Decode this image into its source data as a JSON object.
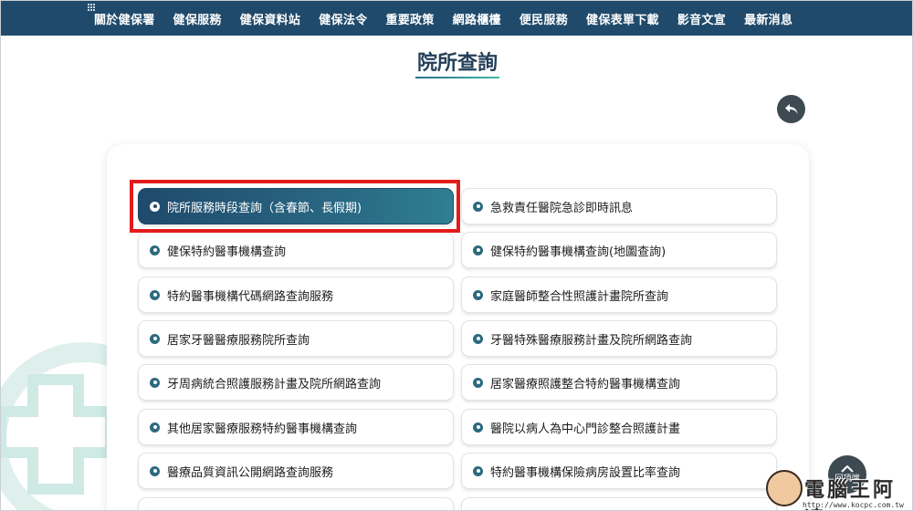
{
  "nav": {
    "items": [
      {
        "label": "關於健保署"
      },
      {
        "label": "健保服務"
      },
      {
        "label": "健保資料站"
      },
      {
        "label": "健保法令"
      },
      {
        "label": "重要政策"
      },
      {
        "label": "網路櫃檯"
      },
      {
        "label": "便民服務"
      },
      {
        "label": "健保表單下載"
      },
      {
        "label": "影音文宣"
      },
      {
        "label": "最新消息"
      }
    ]
  },
  "page": {
    "title": "院所查詢"
  },
  "links": [
    {
      "label": "院所服務時段查詢（含春節、長假期)",
      "active": true
    },
    {
      "label": "急救責任醫院急診即時訊息"
    },
    {
      "label": "健保特約醫事機構查詢"
    },
    {
      "label": "健保特約醫事機構查詢(地圖查詢)"
    },
    {
      "label": "特約醫事機構代碼網路查詢服務"
    },
    {
      "label": "家庭醫師整合性照護計畫院所查詢"
    },
    {
      "label": "居家牙醫醫療服務院所查詢"
    },
    {
      "label": "牙醫特殊醫療服務計畫及院所網路查詢"
    },
    {
      "label": "牙周病統合照護服務計畫及院所網路查詢"
    },
    {
      "label": "居家醫療照護整合特約醫事機構查詢"
    },
    {
      "label": "其他居家醫療服務特約醫事機構查詢"
    },
    {
      "label": "醫院以病人為中心門診整合照護計畫"
    },
    {
      "label": "醫療品質資訊公開網路查詢服務"
    },
    {
      "label": "特約醫事機構保險病房設置比率查詢"
    }
  ],
  "totop": {
    "label": "回頂端"
  },
  "watermark": {
    "brand": "電腦王阿達",
    "url": "http://www.kocpc.com.tw"
  },
  "colors": {
    "nav_bg": "#1f4a6b",
    "highlight": "#e31c1c",
    "accent": "#2c6a7e"
  }
}
